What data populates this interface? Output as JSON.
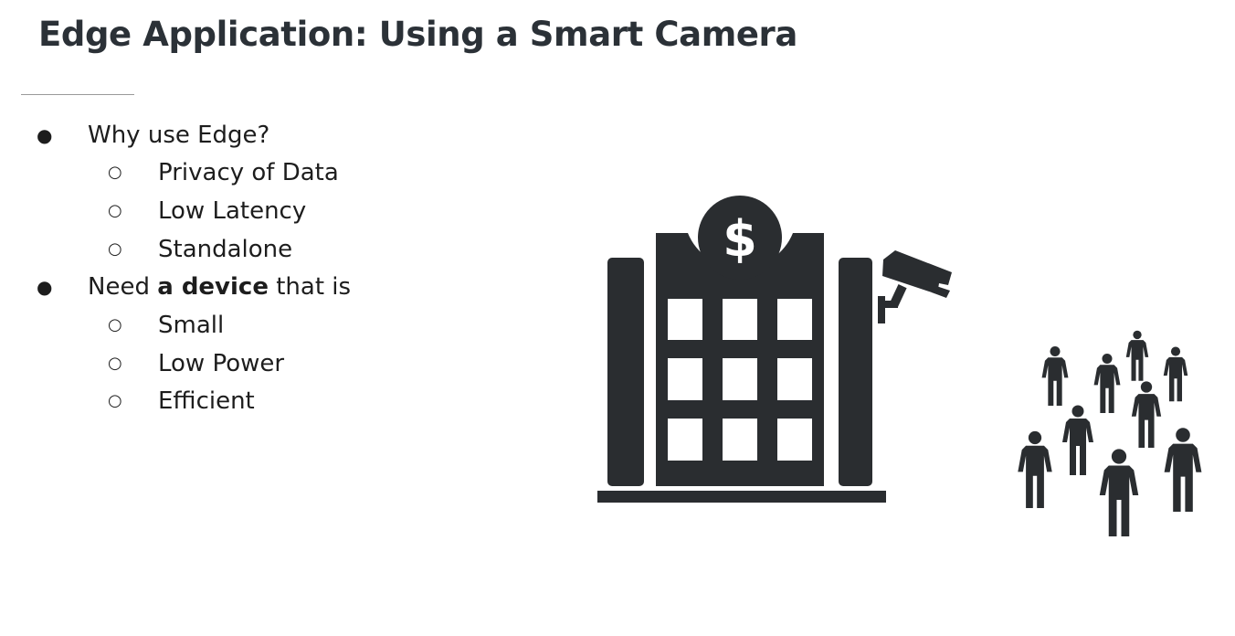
{
  "slide": {
    "title": "Edge Application: Using a Smart Camera",
    "bullets": [
      {
        "marker": "●",
        "text": "Why use Edge?",
        "subitems": [
          {
            "marker": "○",
            "text": "Privacy of Data"
          },
          {
            "marker": "○",
            "text": "Low Latency"
          },
          {
            "marker": "○",
            "text": "Standalone"
          }
        ]
      },
      {
        "marker": "●",
        "text_pre": "Need ",
        "text_bold": "a device",
        "text_post": " that is",
        "subitems": [
          {
            "marker": "○",
            "text": "Small"
          },
          {
            "marker": "○",
            "text": "Low Power"
          },
          {
            "marker": "○",
            "text": "Efficient"
          }
        ]
      }
    ]
  },
  "illustration": {
    "building_sign": "$",
    "icons": [
      "bank-building-icon",
      "security-camera-icon",
      "crowd-people-icon"
    ],
    "icon_color": "#2a2d30"
  }
}
